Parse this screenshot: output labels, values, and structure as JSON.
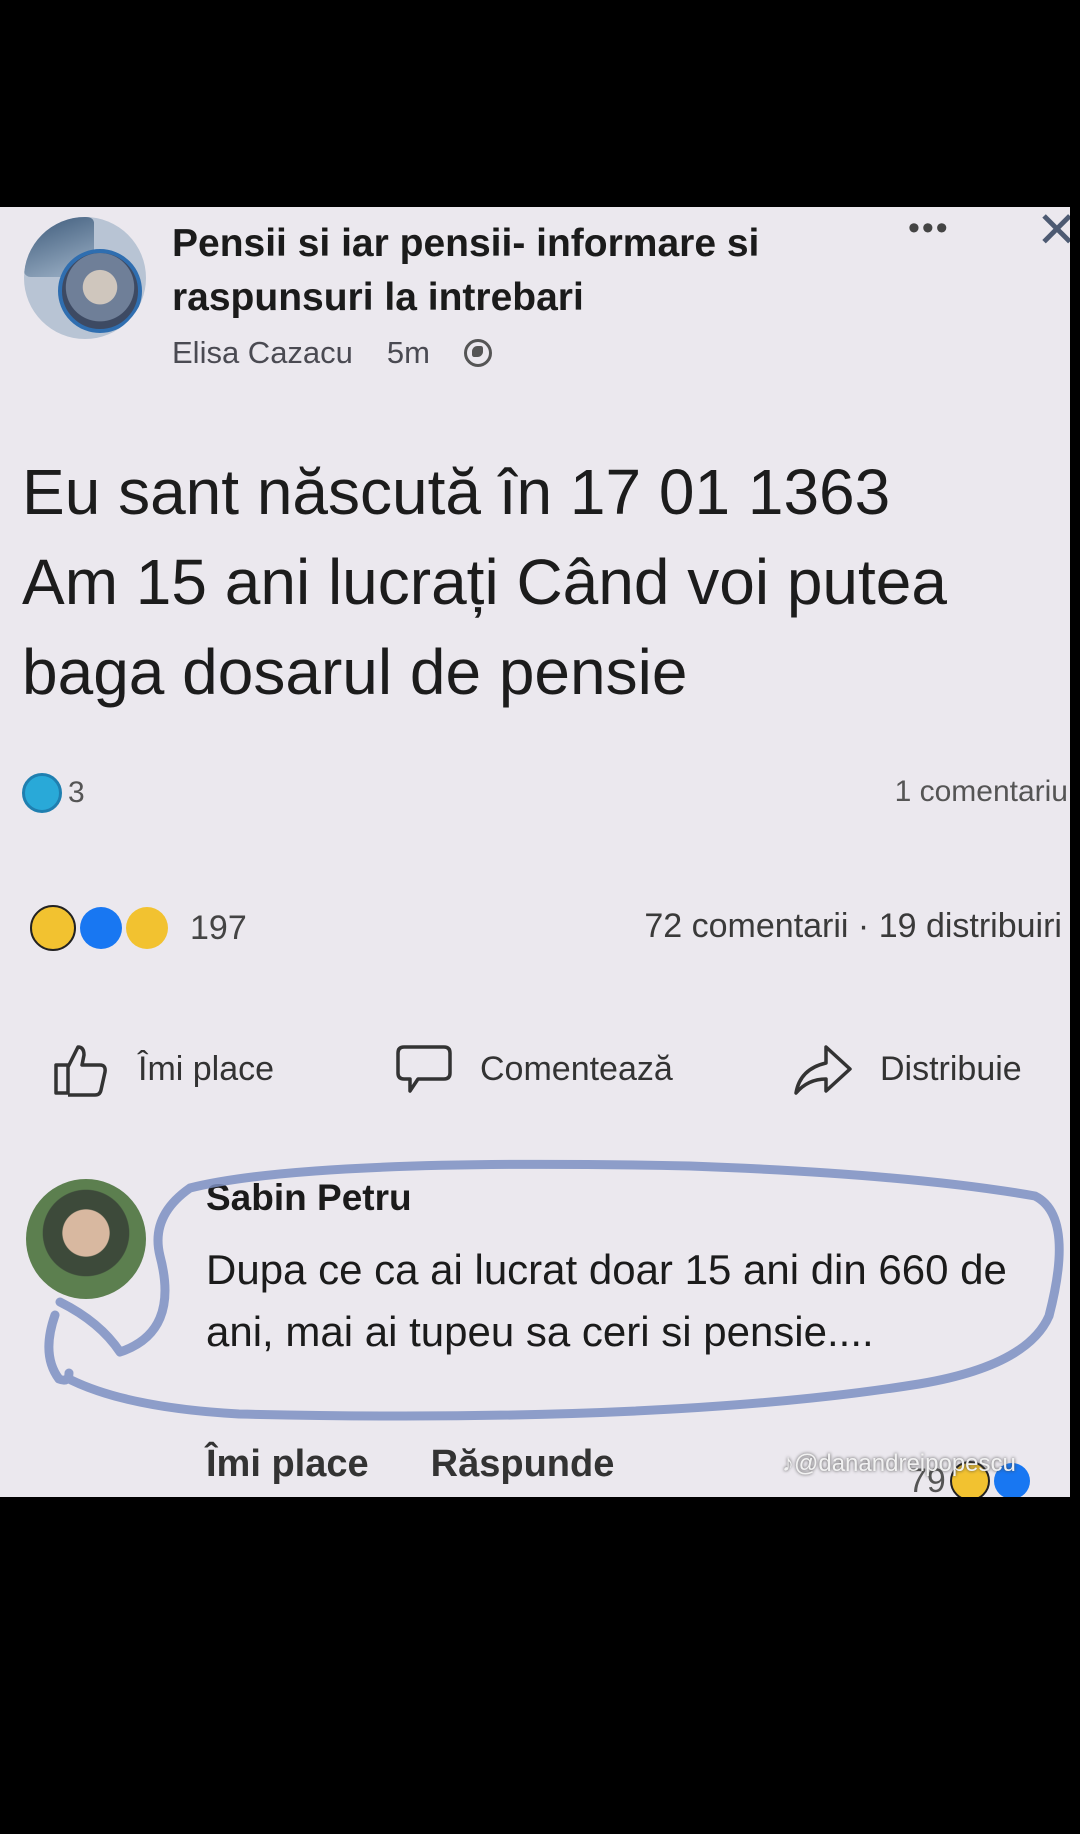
{
  "post": {
    "group_title": "Pensii si iar pensii- informare si raspunsuri la intrebari",
    "author": "Elisa Cazacu",
    "time": "5m",
    "menu_icon": "more-icon",
    "close_icon": "close-icon",
    "text": "Eu sant născută în 17 01 1363\nAm 15 ani lucrați Când voi putea\nbaga dosarul de pensie",
    "inner_reaction_count": "3",
    "inner_comments": "1 comentariu",
    "reaction_count": "197",
    "stats": "72 comentarii · 19 distribuiri",
    "actions": {
      "like": "Îmi place",
      "comment": "Comentează",
      "share": "Distribuie"
    }
  },
  "comment": {
    "author": "Sabin Petru",
    "text": "Dupa ce ca ai lucrat doar 15 ani din 660 de ani, mai ai tupeu sa ceri si pensie....",
    "like": "Îmi place",
    "reply": "Răspunde",
    "reaction_count": "79"
  },
  "watermark": "@danandreipopescu",
  "colors": {
    "page_bg": "#ebe8ee",
    "frame_bg": "#000000",
    "highlight": "#7d8fc2",
    "like_blue": "#1877f2"
  }
}
